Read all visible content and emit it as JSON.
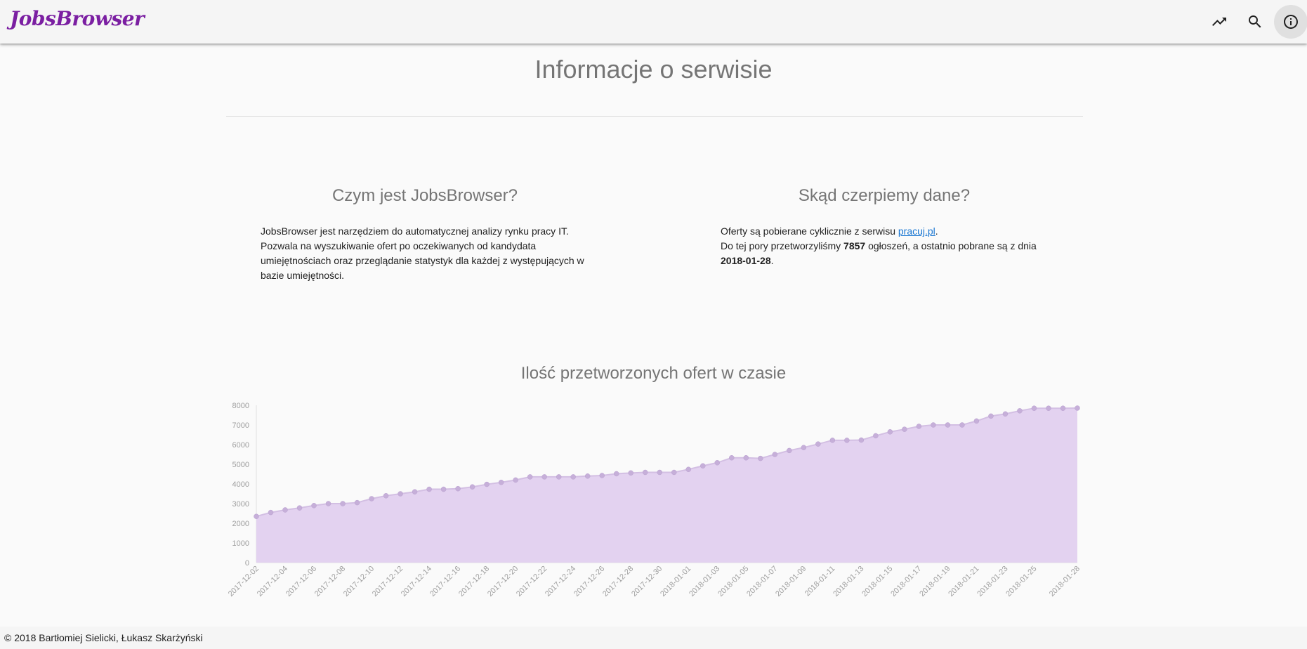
{
  "app": {
    "logo": "JobsBrowser",
    "toolbar_icons": [
      {
        "name": "trending-icon",
        "label": "Statystyki"
      },
      {
        "name": "search-icon",
        "label": "Szukaj"
      },
      {
        "name": "info-icon",
        "label": "Informacje",
        "active": true
      }
    ]
  },
  "page": {
    "title": "Informacje o serwisie"
  },
  "about": {
    "heading": "Czym jest JobsBrowser?",
    "text": "JobsBrowser jest narzędziem do automatycznej analizy rynku pracy IT. Pozwala na wyszukiwanie ofert po oczekiwanych od kandydata umiejętnościach oraz przeglądanie statystyk dla każdej z występujących w bazie umiejętności."
  },
  "source": {
    "heading": "Skąd czerpiemy dane?",
    "line1_prefix": "Oferty są pobierane cyklicznie z serwisu ",
    "link_text": "pracuj.pl",
    "line1_suffix": ".",
    "line2_prefix": "Do tej pory przetworzyliśmy ",
    "count": "7857",
    "line2_middle": " ogłoszeń, a ostatnio pobrane są z dnia ",
    "last_date": "2018-01-28",
    "line2_suffix": "."
  },
  "chart_title": "Ilość przetworzonych ofert w czasie",
  "chart_data": {
    "type": "area",
    "xlabel": "",
    "ylabel": "",
    "ylim": [
      0,
      8000
    ],
    "yticks": [
      0,
      1000,
      2000,
      3000,
      4000,
      5000,
      6000,
      7000,
      8000
    ],
    "grid": false,
    "legend": "none",
    "x": [
      "2017-12-02",
      "2017-12-03",
      "2017-12-04",
      "2017-12-05",
      "2017-12-06",
      "2017-12-07",
      "2017-12-08",
      "2017-12-09",
      "2017-12-10",
      "2017-12-11",
      "2017-12-12",
      "2017-12-13",
      "2017-12-14",
      "2017-12-15",
      "2017-12-16",
      "2017-12-17",
      "2017-12-18",
      "2017-12-19",
      "2017-12-20",
      "2017-12-21",
      "2017-12-22",
      "2017-12-23",
      "2017-12-24",
      "2017-12-25",
      "2017-12-26",
      "2017-12-27",
      "2017-12-28",
      "2017-12-29",
      "2017-12-30",
      "2017-12-31",
      "2018-01-01",
      "2018-01-02",
      "2018-01-03",
      "2018-01-04",
      "2018-01-05",
      "2018-01-06",
      "2018-01-07",
      "2018-01-08",
      "2018-01-09",
      "2018-01-10",
      "2018-01-11",
      "2018-01-12",
      "2018-01-13",
      "2018-01-14",
      "2018-01-15",
      "2018-01-16",
      "2018-01-17",
      "2018-01-18",
      "2018-01-19",
      "2018-01-20",
      "2018-01-21",
      "2018-01-22",
      "2018-01-23",
      "2018-01-24",
      "2018-01-25",
      "2018-01-26",
      "2018-01-27",
      "2018-01-28"
    ],
    "xticks": [
      "2017-12-02",
      "2017-12-04",
      "2017-12-06",
      "2017-12-08",
      "2017-12-10",
      "2017-12-12",
      "2017-12-14",
      "2017-12-16",
      "2017-12-18",
      "2017-12-20",
      "2017-12-22",
      "2017-12-24",
      "2017-12-26",
      "2017-12-28",
      "2017-12-30",
      "2018-01-01",
      "2018-01-03",
      "2018-01-05",
      "2018-01-07",
      "2018-01-09",
      "2018-01-11",
      "2018-01-13",
      "2018-01-15",
      "2018-01-17",
      "2018-01-19",
      "2018-01-21",
      "2018-01-23",
      "2018-01-25",
      "2018-01-28"
    ],
    "values": [
      2350,
      2550,
      2680,
      2780,
      2900,
      3000,
      3000,
      3050,
      3250,
      3400,
      3500,
      3600,
      3730,
      3730,
      3760,
      3850,
      3980,
      4080,
      4200,
      4360,
      4360,
      4360,
      4360,
      4400,
      4430,
      4520,
      4560,
      4590,
      4590,
      4590,
      4740,
      4920,
      5080,
      5330,
      5330,
      5300,
      5500,
      5700,
      5850,
      6030,
      6220,
      6220,
      6230,
      6450,
      6650,
      6780,
      6930,
      7000,
      7000,
      7000,
      7200,
      7450,
      7560,
      7720,
      7850,
      7850,
      7850,
      7857
    ],
    "color": "#ce93d8"
  },
  "footer": {
    "copyright": "© 2018  Bartłomiej Sielicki, Łukasz Skarżyński"
  }
}
